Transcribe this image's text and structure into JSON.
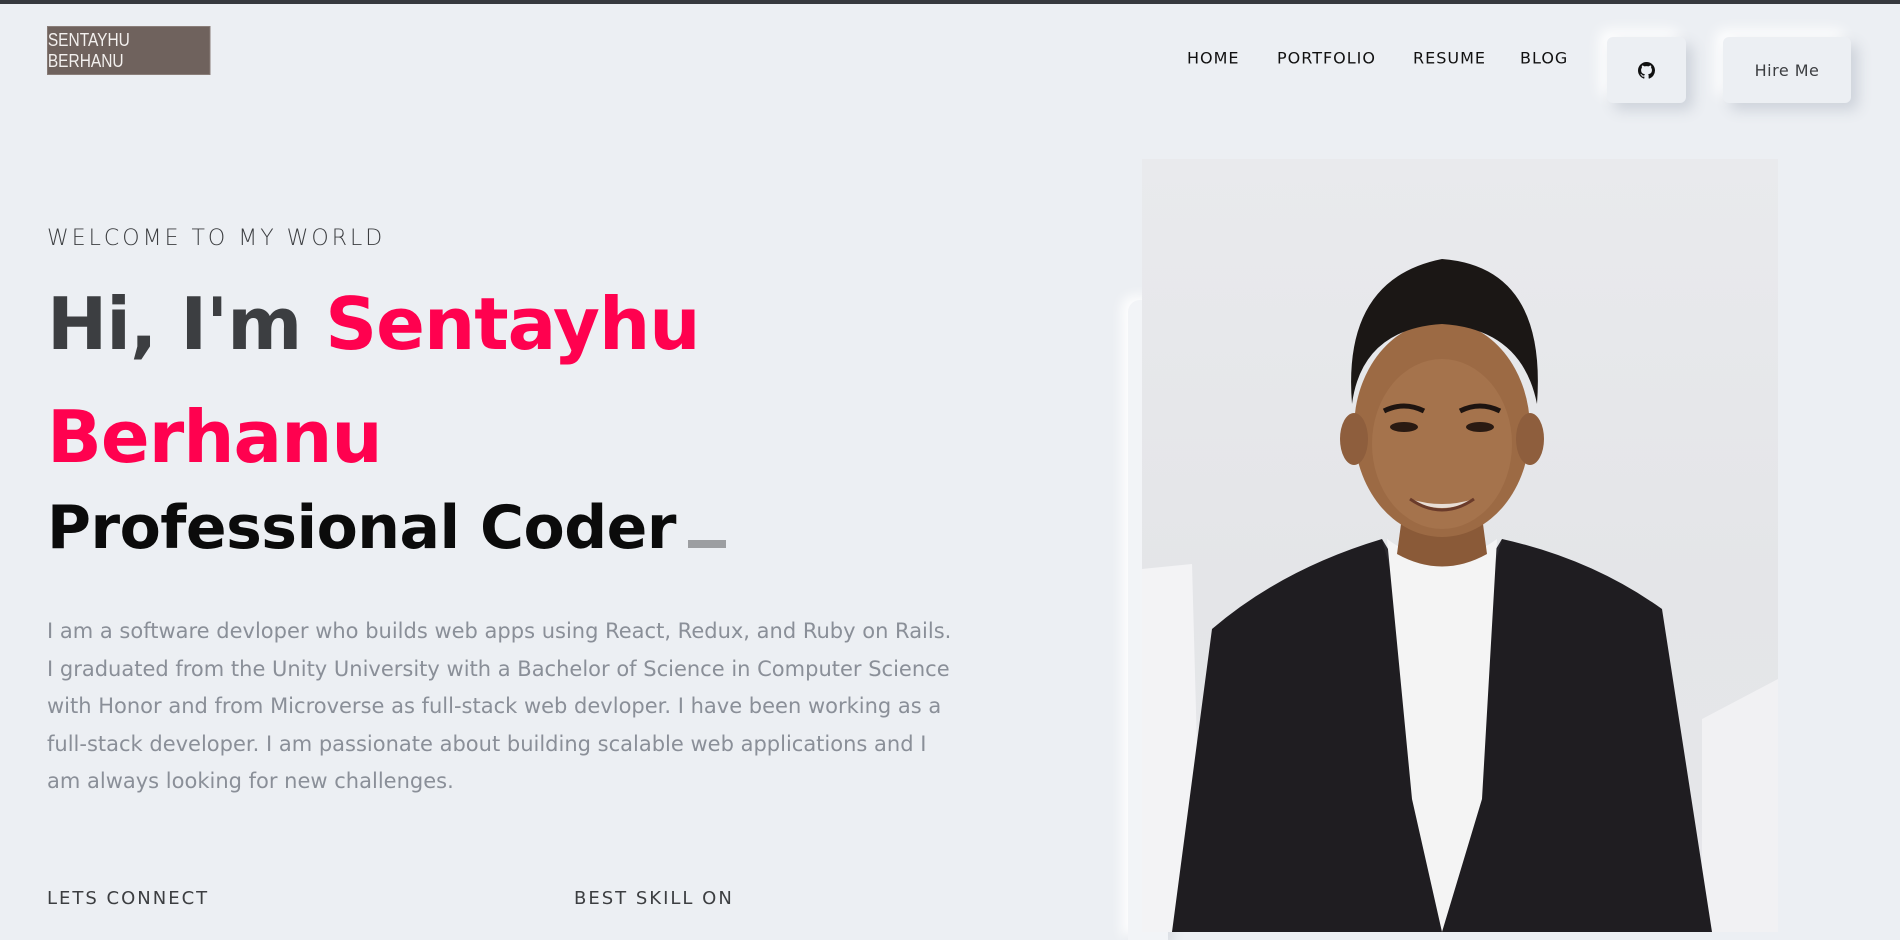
{
  "header": {
    "logo_text": "SENTAYHU BERHANU",
    "nav": [
      {
        "label": "HOME"
      },
      {
        "label": "PORTFOLIO"
      },
      {
        "label": "RESUME"
      },
      {
        "label": "BLOG"
      }
    ],
    "github_icon": "github-icon",
    "hire_label": "Hire Me"
  },
  "hero": {
    "welcome": "WELCOME TO MY WORLD",
    "greeting": "Hi, I'm ",
    "name": "Sentayhu Berhanu",
    "role": "Professional Coder",
    "bio": "I am a software devloper who builds web apps using React, Redux, and Ruby on Rails. I graduated from the Unity University with a Bachelor of Science in Computer Science with Honor and from Microverse as full-stack web devloper. I have been working as a full-stack developer. I am passionate about building scalable web applications and I am always looking for new challenges.",
    "connect_label": "LETS CONNECT",
    "skill_label": "BEST SKILL ON"
  },
  "colors": {
    "accent": "#ff014f",
    "background": "#eceff3",
    "text": "#3c3e41",
    "muted": "#8a8f98"
  }
}
